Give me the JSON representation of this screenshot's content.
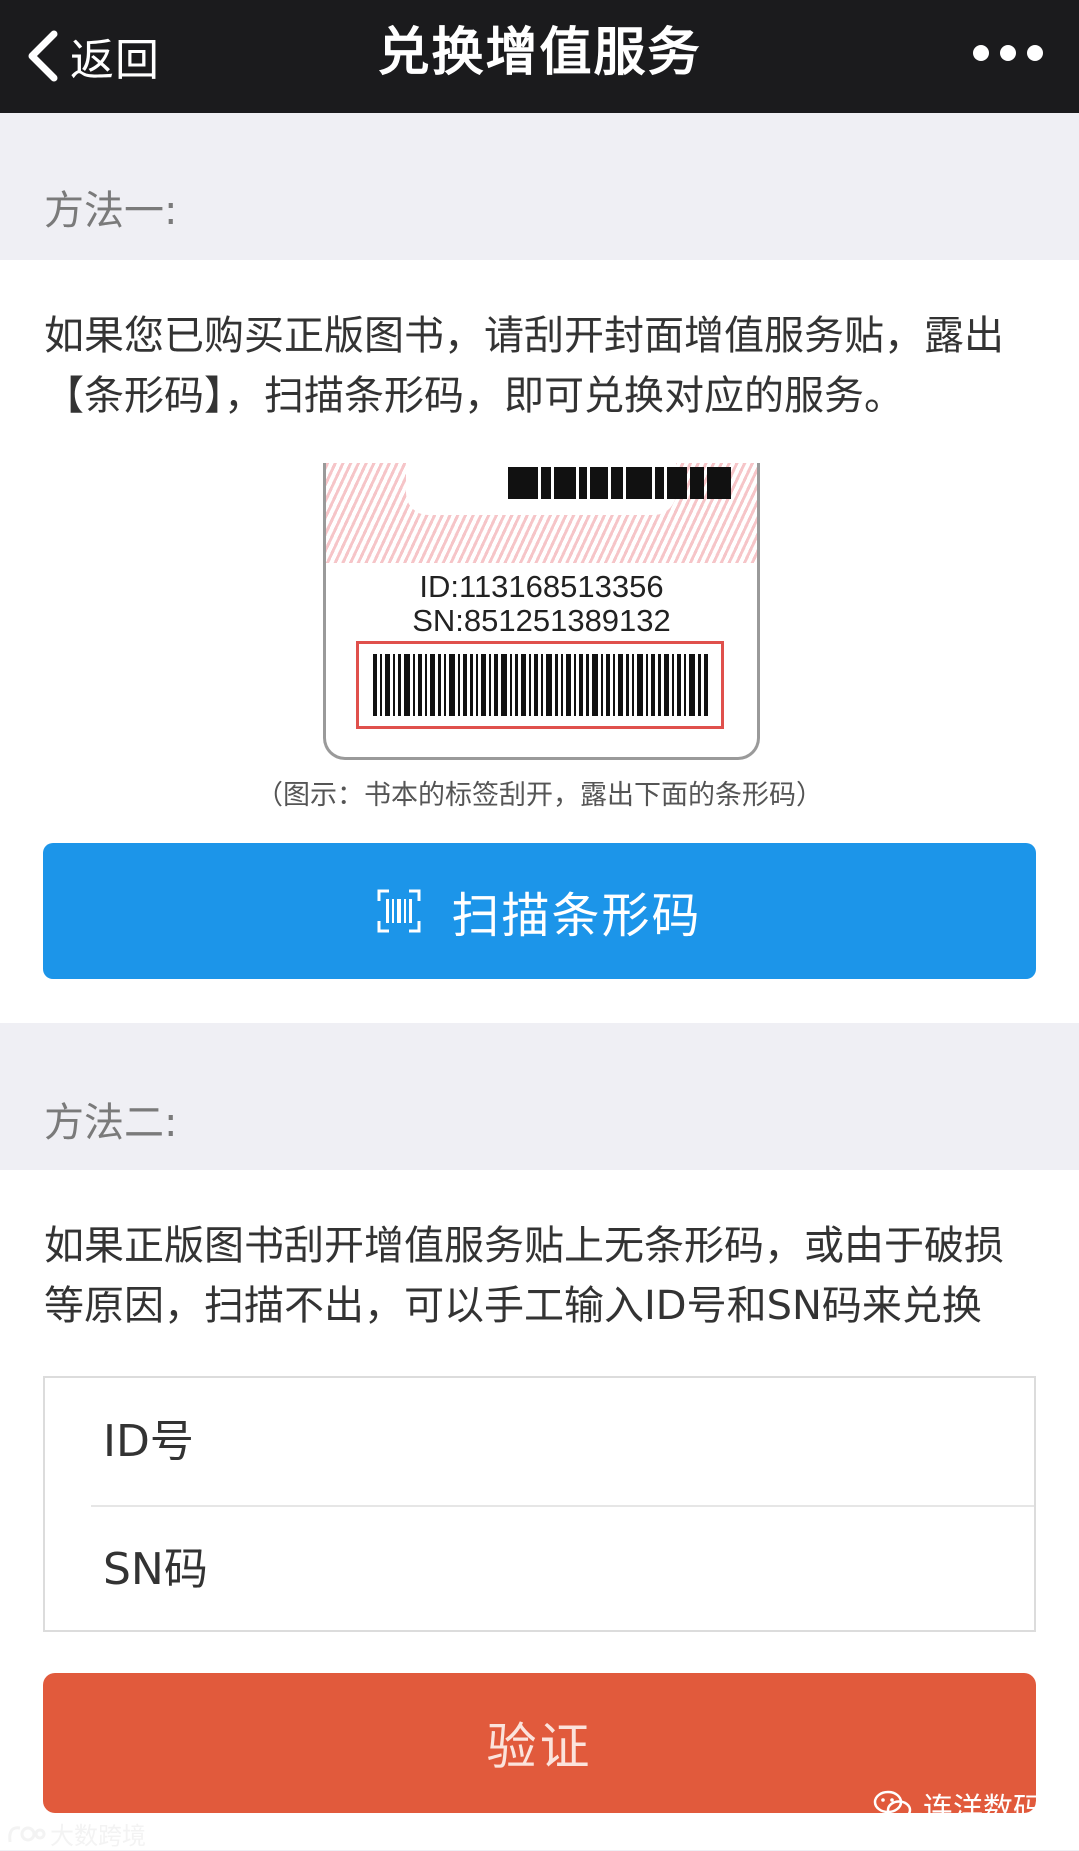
{
  "navbar": {
    "back_label": "返回",
    "title": "兑换增值服务",
    "more_icon": "more-dots-icon"
  },
  "method_one": {
    "label": "方法一:",
    "description": "如果您已购买正版图书，请刮开封面增值服务贴，露出【条形码】，扫描条形码，即可兑换对应的服务。",
    "illustration": {
      "id_text": "ID:113168513356",
      "sn_text": "SN:851251389132"
    },
    "caption": "（图示：书本的标签刮开，露出下面的条形码）",
    "scan_button_label": "扫描条形码",
    "scan_icon": "barcode-scan-icon"
  },
  "method_two": {
    "label": "方法二:",
    "description": "如果正版图书刮开增值服务贴上无条形码，或由于破损等原因，扫描不出，可以手工输入ID号和SN码来兑换",
    "id_field": {
      "placeholder": "ID号",
      "value": ""
    },
    "sn_field": {
      "placeholder": "SN码",
      "value": ""
    },
    "verify_button_label": "验证"
  },
  "watermarks": {
    "right": "连洋数码",
    "left": "大数跨境"
  },
  "colors": {
    "navbar_bg": "#1b1b1d",
    "page_bg": "#efeff4",
    "scan_button": "#1c95e9",
    "verify_button": "#e15a3c",
    "barcode_frame": "#e0504c"
  }
}
